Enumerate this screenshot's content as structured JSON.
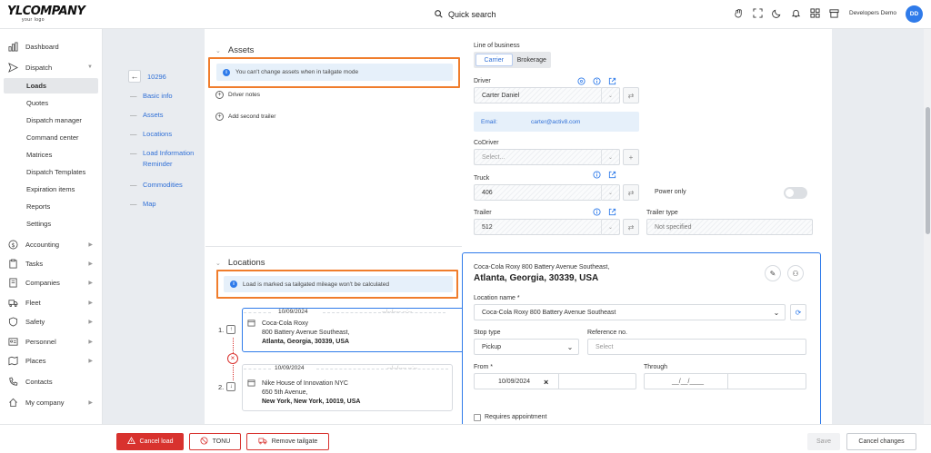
{
  "header": {
    "logo_main": "YLCOMPANY",
    "logo_sub": "your logo",
    "search_label": "Quick search",
    "user_name": "Developers Demo",
    "user_initials": "DD"
  },
  "sidebar": {
    "items": [
      {
        "label": "Dashboard",
        "icon": "chart-icon"
      },
      {
        "label": "Dispatch",
        "icon": "send-icon"
      },
      {
        "label": "Accounting",
        "icon": "dollar-icon"
      },
      {
        "label": "Tasks",
        "icon": "clipboard-icon"
      },
      {
        "label": "Companies",
        "icon": "building-icon"
      },
      {
        "label": "Fleet",
        "icon": "truck-icon"
      },
      {
        "label": "Safety",
        "icon": "shield-icon"
      },
      {
        "label": "Personnel",
        "icon": "id-card-icon"
      },
      {
        "label": "Places",
        "icon": "map-icon"
      },
      {
        "label": "Contacts",
        "icon": "phone-icon"
      },
      {
        "label": "My company",
        "icon": "home-icon"
      }
    ],
    "dispatch_sub": [
      "Loads",
      "Quotes",
      "Dispatch manager",
      "Command center",
      "Matrices",
      "Dispatch Templates",
      "Expiration items",
      "Reports",
      "Settings"
    ]
  },
  "load_nav": {
    "load_number": "10296",
    "sections": [
      "Basic info",
      "Assets",
      "Locations",
      "Load Information",
      "Reminder",
      "Commodities",
      "Map"
    ]
  },
  "assets": {
    "title": "Assets",
    "info": "You can't change assets when in tailgate mode",
    "driver_notes": "Driver notes",
    "add_trailer": "Add second trailer",
    "line_of_business_label": "Line of business",
    "lob_options": [
      "Carrier",
      "Brokerage"
    ],
    "driver_label": "Driver",
    "driver_value": "Carter Daniel",
    "email_label": "Email:",
    "email_value": "carter@activ8.com",
    "codriver_label": "CoDriver",
    "codriver_placeholder": "Select...",
    "truck_label": "Truck",
    "truck_value": "406",
    "power_only_label": "Power only",
    "trailer_label": "Trailer",
    "trailer_value": "512",
    "trailer_type_label": "Trailer type",
    "trailer_type_value": "Not specified"
  },
  "locations": {
    "title": "Locations",
    "info": "Load is marked sa tailgated mileage won't be calculated",
    "stops": [
      {
        "num": "1.",
        "date": "10/09/2024",
        "name": "Coca-Cola Roxy",
        "street": "800 Battery Avenue Southeast,",
        "city": "Atlanta, Georgia, 30339, USA"
      },
      {
        "num": "2.",
        "date": "10/09/2024",
        "name": "Nike House of Innovation NYC",
        "street": "650 5th Avenue,",
        "city": "New York, New York, 10019, USA"
      }
    ],
    "dash_placeholder": "--/--/---- --:--",
    "detail": {
      "address_line": "Coca-Cola Roxy 800 Battery Avenue Southeast,",
      "address_city": "Atlanta, Georgia, 30339, USA",
      "location_name_label": "Location name *",
      "location_name_value": "Coca-Cola Roxy 800 Battery Avenue Southeast",
      "stop_type_label": "Stop type",
      "stop_type_value": "Pickup",
      "reference_label": "Reference no.",
      "reference_placeholder": "Select",
      "from_label": "From *",
      "from_value": "10/09/2024",
      "through_label": "Through",
      "through_value": "__/__/____",
      "requires_appointment": "Requires appointment"
    }
  },
  "footer": {
    "cancel_load": "Cancel load",
    "tonu": "TONU",
    "remove_tailgate": "Remove tailgate",
    "save": "Save",
    "cancel_changes": "Cancel changes"
  },
  "colors": {
    "accent": "#2f7bea",
    "danger": "#d8322e",
    "highlight": "#f07d2c"
  }
}
